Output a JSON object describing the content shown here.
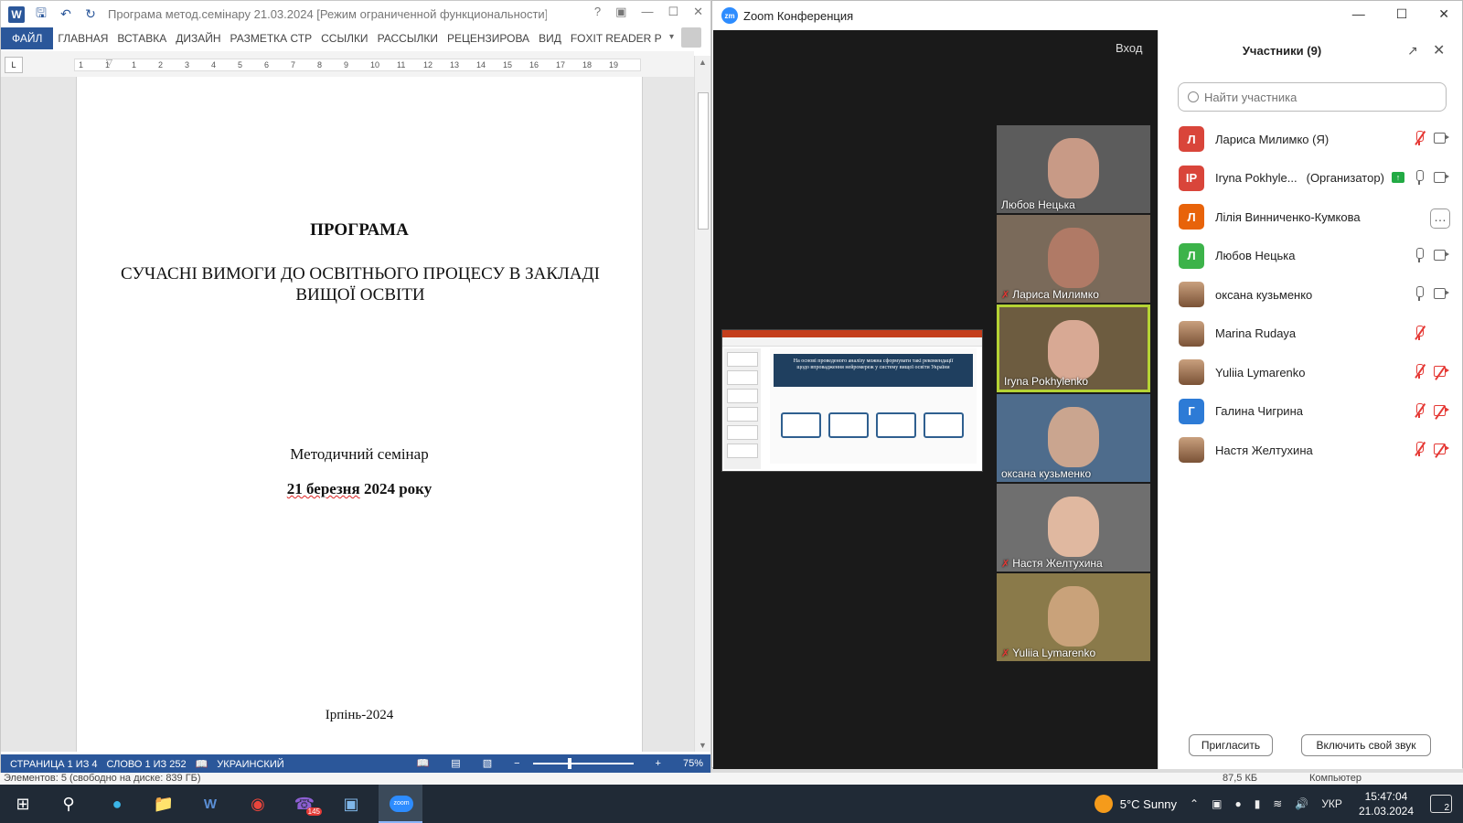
{
  "word": {
    "title": "Програма метод.семінару 21.03.2024 [Режим ограниченной функциональности]...",
    "help": "?",
    "tabs": [
      "ФАЙЛ",
      "ГЛАВНАЯ",
      "ВСТАВКА",
      "ДИЗАЙН",
      "РАЗМЕТКА СТР",
      "ССЫЛКИ",
      "РАССЫЛКИ",
      "РЕЦЕНЗИРОВА",
      "ВИД",
      "FOXIT READER P"
    ],
    "ruler": [
      "1",
      "1",
      "1",
      "2",
      "3",
      "4",
      "5",
      "6",
      "7",
      "8",
      "9",
      "10",
      "11",
      "12",
      "13",
      "14",
      "15",
      "16",
      "17",
      "18",
      "19"
    ],
    "tab_stop": "L",
    "doc": {
      "title": "ПРОГРАМА",
      "subtitle": "СУЧАСНІ ВИМОГИ ДО ОСВІТНЬОГО ПРОЦЕСУ В ЗАКЛАДІ ВИЩОЇ ОСВІТИ",
      "seminar": "Методичний семінар",
      "date_word": "21 березня",
      "date_rest": " 2024 року",
      "city": "Ірпінь-2024"
    },
    "status": {
      "page": "СТРАНИЦА 1 ИЗ 4",
      "words": "СЛОВО 1 ИЗ 252",
      "lang": "УКРАИНСКИЙ",
      "zoom_minus": "−",
      "zoom_plus": "+",
      "zoom": "75%"
    }
  },
  "explorer": {
    "elements": "Элементов: 5 (свободно на диске: 839 ГБ)",
    "size": "87,5 КБ",
    "location": "Компьютер"
  },
  "zoom": {
    "title": "Zoom Конференция",
    "logo": "zm",
    "enter": "Вход",
    "slide_text": "На основі проведеного аналізу можна сформувати такі рекомендації щодо впровадження нейромереж у систему вищої освіти України",
    "tiles": [
      {
        "name": "Любов Нецька",
        "muted": false,
        "active": false
      },
      {
        "name": "Лариса Милимко",
        "muted": true,
        "active": false
      },
      {
        "name": "Iryna Pokhylenko",
        "muted": false,
        "active": true
      },
      {
        "name": "оксана кузьменко",
        "muted": false,
        "active": false
      },
      {
        "name": "Настя Желтухина",
        "muted": true,
        "active": false
      },
      {
        "name": "Yuliia Lymarenko",
        "muted": true,
        "active": false
      }
    ],
    "panel": {
      "title": "Участники (9)",
      "search_placeholder": "Найти участника",
      "invite": "Пригласить",
      "unmute": "Включить свой звук",
      "participants": [
        {
          "initial": "Л",
          "color": "#d9453a",
          "name": "Лариса Милимко (Я)",
          "role": "",
          "mic": "muted",
          "cam": "on",
          "share": false,
          "more": false
        },
        {
          "initial": "IP",
          "color": "#d9453a",
          "name": "Iryna Pokhyle...",
          "role": "(Организатор)",
          "mic": "on",
          "cam": "on",
          "share": true,
          "more": false
        },
        {
          "initial": "Л",
          "color": "#e8630a",
          "name": "Лілія Винниченко-Кумкова",
          "role": "",
          "mic": "none",
          "cam": "none",
          "share": false,
          "more": true
        },
        {
          "initial": "Л",
          "color": "#3cb34a",
          "name": "Любов Нецька",
          "role": "",
          "mic": "on",
          "cam": "on",
          "share": false,
          "more": false
        },
        {
          "initial": "",
          "color": "photo",
          "name": "оксана кузьменко",
          "role": "",
          "mic": "on",
          "cam": "on",
          "share": false,
          "more": false
        },
        {
          "initial": "",
          "color": "photo",
          "name": "Marina Rudaya",
          "role": "",
          "mic": "muted",
          "cam": "none",
          "share": false,
          "more": false
        },
        {
          "initial": "",
          "color": "photo",
          "name": "Yuliia Lymarenko",
          "role": "",
          "mic": "muted",
          "cam": "off",
          "share": false,
          "more": false
        },
        {
          "initial": "Г",
          "color": "#2d7bd6",
          "name": "Галина Чигрина",
          "role": "",
          "mic": "muted",
          "cam": "off",
          "share": false,
          "more": false
        },
        {
          "initial": "",
          "color": "photo",
          "name": "Настя Желтухина",
          "role": "",
          "mic": "muted",
          "cam": "off",
          "share": false,
          "more": false
        }
      ]
    }
  },
  "taskbar": {
    "apps": [
      "start-icon",
      "search-icon",
      "edge-icon",
      "file-explorer-icon",
      "word-icon",
      "chrome-icon",
      "viber-icon",
      "photos-icon",
      "zoom-icon"
    ],
    "viber_badge": "145",
    "zoom_label": "zoom",
    "weather": "5°C  Sunny",
    "lang": "УКР",
    "time": "15:47:04",
    "date": "21.03.2024",
    "notif_count": "2"
  }
}
